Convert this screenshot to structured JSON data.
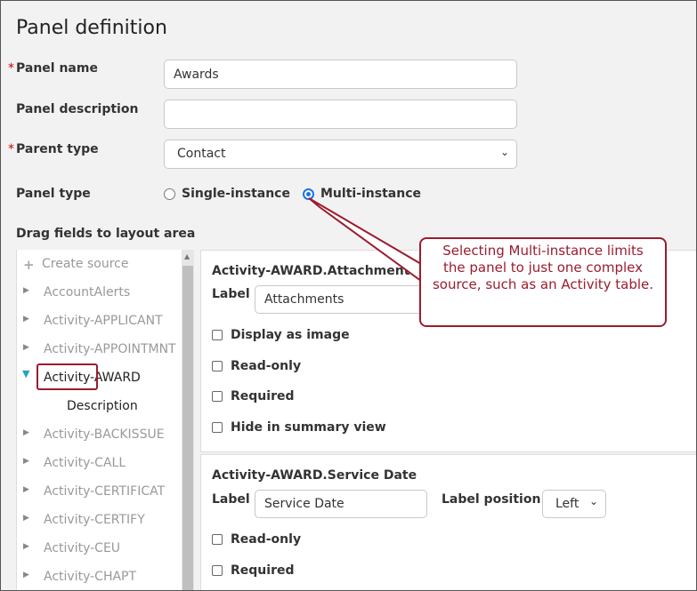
{
  "page": {
    "title": "Panel definition"
  },
  "form": {
    "panel_name_label": "Panel name",
    "panel_name_value": "Awards",
    "panel_description_label": "Panel description",
    "panel_description_value": "",
    "parent_type_label": "Parent type",
    "parent_type_value": "Contact",
    "panel_type_label": "Panel type",
    "panel_type_options": [
      "Single-instance",
      "Multi-instance"
    ],
    "panel_type_selected": "Multi-instance",
    "required_marker": "*"
  },
  "tree": {
    "heading": "Drag fields to layout area",
    "create_source": "Create source",
    "items": [
      "AccountAlerts",
      "Activity-APPLICANT",
      "Activity-APPOINTMNT",
      "Activity-AWARD",
      "Description",
      "Activity-BACKISSUE",
      "Activity-CALL",
      "Activity-CERTIFICAT",
      "Activity-CERTIFY",
      "Activity-CEU",
      "Activity-CHAPT"
    ]
  },
  "cards": [
    {
      "title": "Activity-AWARD.Attachments",
      "label_caption": "Label",
      "label_value": "Attachments",
      "checkboxes": [
        "Display as image",
        "Read-only",
        "Required",
        "Hide in summary view"
      ]
    },
    {
      "title": "Activity-AWARD.Service Date",
      "label_caption": "Label",
      "label_value": "Service Date",
      "label_position_caption": "Label position",
      "label_position_value": "Left",
      "checkboxes": [
        "Read-only",
        "Required"
      ]
    }
  ],
  "callout": {
    "text": "Selecting Multi-instance limits the panel to just one complex source, such as an Activity table."
  },
  "colors": {
    "accent": "#1a73e8",
    "callout": "#9b1c2e",
    "required": "#cc0000"
  }
}
